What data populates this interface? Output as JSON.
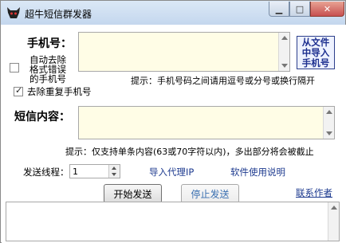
{
  "window": {
    "title": "超牛短信群发器"
  },
  "phone": {
    "label": "手机号：",
    "value": "",
    "import_button": [
      "从文件",
      "中导入",
      "手机号"
    ]
  },
  "options": {
    "auto_remove_label": [
      "自动去除",
      "格式错误",
      "的手机号"
    ],
    "auto_remove_checked": false,
    "dedupe_label": "去除重复手机号",
    "dedupe_checked": true
  },
  "hints": {
    "phone_separator": "提示：手机号码之间请用逗号或分号或换行隔开",
    "content_limit": "提示：仅支持单条内容(63或70字符以内)，多出部分将会被截止"
  },
  "sms": {
    "label": "短信内容：",
    "value": ""
  },
  "send_threads": {
    "label": "发送线程：",
    "value": "1"
  },
  "links": {
    "import_proxy": "导入代理IP",
    "usage": "软件使用说明",
    "contact_author": "联系作者"
  },
  "buttons": {
    "start": "开始发送",
    "stop": "停止发送"
  }
}
